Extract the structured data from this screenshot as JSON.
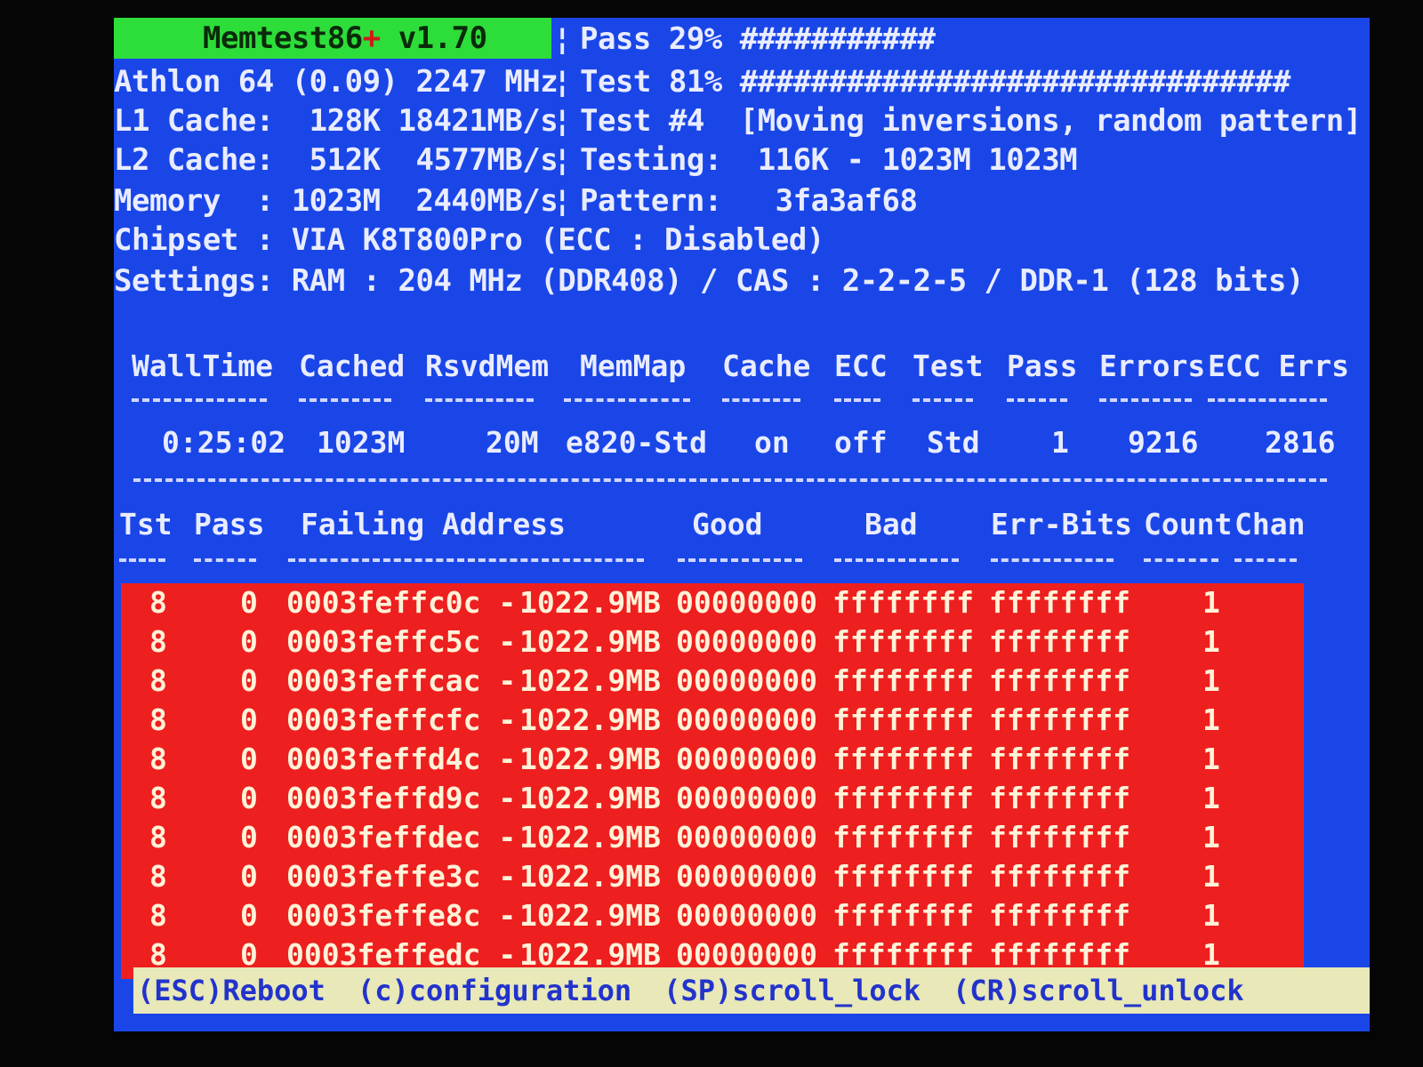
{
  "title": {
    "name": "Memtest86",
    "plus": "+",
    "version": "v1.70"
  },
  "progress": {
    "pass_label": "Pass 29%",
    "pass_percent": 29,
    "pass_bar": "###########",
    "test_label": "Test 81%",
    "test_percent": 81,
    "test_bar": "###############################",
    "test_number": "Test #4  [Moving inversions, random pattern]",
    "testing": "Testing:  116K - 1023M 1023M",
    "pattern": "Pattern:   3fa3af68"
  },
  "system": {
    "cpu": "Athlon 64 (0.09) 2247 MHz",
    "l1": "L1 Cache:  128K 18421MB/s",
    "l2": "L2 Cache:  512K  4577MB/s",
    "memory": "Memory  : 1023M  2440MB/s",
    "chipset": "Chipset : VIA K8T800Pro (ECC : Disabled)",
    "settings": "Settings: RAM : 204 MHz (DDR408) / CAS : 2-2-2-5 / DDR-1 (128 bits)"
  },
  "stats": {
    "headers": [
      "WallTime",
      "Cached",
      "RsvdMem",
      "MemMap",
      "Cache",
      "ECC",
      "Test",
      "Pass",
      "Errors",
      "ECC Errs"
    ],
    "values": [
      "0:25:02",
      "1023M",
      "20M",
      "e820-Std",
      "on",
      "off",
      "Std",
      "1",
      "9216",
      "2816"
    ]
  },
  "errors": {
    "headers": [
      "Tst",
      "Pass",
      "Failing Address",
      "Good",
      "Bad",
      "Err-Bits",
      "Count",
      "Chan"
    ],
    "rows": [
      {
        "tst": "8",
        "pass": "0",
        "addr": "0003feffc0c -",
        "mb": "1022.9MB",
        "good": "00000000",
        "bad": "ffffffff",
        "bits": "ffffffff",
        "count": "1"
      },
      {
        "tst": "8",
        "pass": "0",
        "addr": "0003feffc5c -",
        "mb": "1022.9MB",
        "good": "00000000",
        "bad": "ffffffff",
        "bits": "ffffffff",
        "count": "1"
      },
      {
        "tst": "8",
        "pass": "0",
        "addr": "0003feffcac -",
        "mb": "1022.9MB",
        "good": "00000000",
        "bad": "ffffffff",
        "bits": "ffffffff",
        "count": "1"
      },
      {
        "tst": "8",
        "pass": "0",
        "addr": "0003feffcfc -",
        "mb": "1022.9MB",
        "good": "00000000",
        "bad": "ffffffff",
        "bits": "ffffffff",
        "count": "1"
      },
      {
        "tst": "8",
        "pass": "0",
        "addr": "0003feffd4c -",
        "mb": "1022.9MB",
        "good": "00000000",
        "bad": "ffffffff",
        "bits": "ffffffff",
        "count": "1"
      },
      {
        "tst": "8",
        "pass": "0",
        "addr": "0003feffd9c -",
        "mb": "1022.9MB",
        "good": "00000000",
        "bad": "ffffffff",
        "bits": "ffffffff",
        "count": "1"
      },
      {
        "tst": "8",
        "pass": "0",
        "addr": "0003feffdec -",
        "mb": "1022.9MB",
        "good": "00000000",
        "bad": "ffffffff",
        "bits": "ffffffff",
        "count": "1"
      },
      {
        "tst": "8",
        "pass": "0",
        "addr": "0003feffe3c -",
        "mb": "1022.9MB",
        "good": "00000000",
        "bad": "ffffffff",
        "bits": "ffffffff",
        "count": "1"
      },
      {
        "tst": "8",
        "pass": "0",
        "addr": "0003feffe8c -",
        "mb": "1022.9MB",
        "good": "00000000",
        "bad": "ffffffff",
        "bits": "ffffffff",
        "count": "1"
      },
      {
        "tst": "8",
        "pass": "0",
        "addr": "0003feffedc -",
        "mb": "1022.9MB",
        "good": "00000000",
        "bad": "ffffffff",
        "bits": "ffffffff",
        "count": "1"
      }
    ]
  },
  "footer": {
    "reboot": "(ESC)Reboot",
    "config": "(c)configuration",
    "scroll_lock": "(SP)scroll_lock",
    "scroll_unlock": "(CR)scroll_unlock"
  },
  "colors": {
    "screen_bg": "#1a46e8",
    "title_bg": "#2ddd3a",
    "error_bg": "#ee1f1f",
    "footer_bg": "#e8e8b8"
  }
}
